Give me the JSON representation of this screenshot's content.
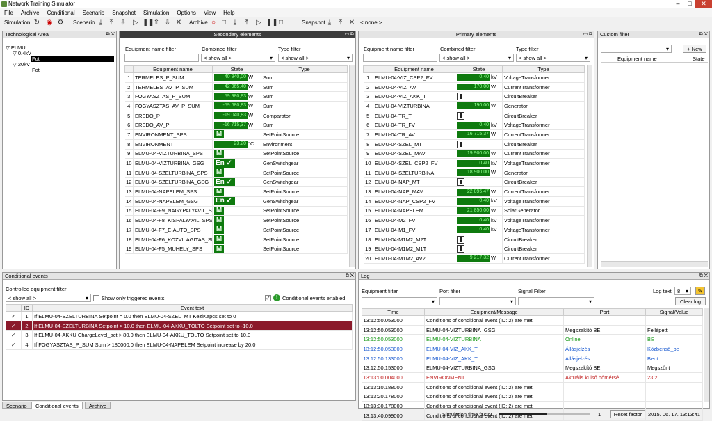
{
  "app": {
    "title": "Network Training Simulator"
  },
  "menu": [
    "File",
    "Archive",
    "Conditional",
    "Scenario",
    "Snapshot",
    "Simulation",
    "Options",
    "View",
    "Help"
  ],
  "toolbar": {
    "simulation": "Simulation",
    "scenario": "Scenario",
    "archive": "Archive",
    "snapshot": "Snapshot",
    "snapshot_value": "< none >"
  },
  "tech_area": {
    "title": "Technological Area",
    "items": [
      "ELMU",
      "0.4kV",
      "Fot",
      "20kV",
      "Fot"
    ]
  },
  "secondary": {
    "title": "Secondary elements",
    "filter_name": "Equipment name filter",
    "filter_combined": "Combined filter",
    "filter_type": "Type filter",
    "show_all": "< show all >",
    "headers": [
      "",
      "Equipment name",
      "State",
      "Type"
    ],
    "rows": [
      [
        "1",
        "TERMELES_P_SUM",
        "40 940,00",
        "W",
        "Sum"
      ],
      [
        "2",
        "TERMELES_AV_P_SUM",
        "42 965,40",
        "W",
        "Sum"
      ],
      [
        "3",
        "FOGYASZTAS_P_SUM",
        "59 980,83",
        "W",
        "Sum"
      ],
      [
        "4",
        "FOGYASZTAS_AV_P_SUM",
        "-59 680,83",
        "W",
        "Sum"
      ],
      [
        "5",
        "EREDO_P",
        "-19 040,83",
        "W",
        "Comparator"
      ],
      [
        "6",
        "EREDO_AV_P",
        "-16 715,37",
        "W",
        "Sum"
      ],
      [
        "7",
        "ENVIRONMENT_SPS",
        "M",
        "",
        "SetPointSource"
      ],
      [
        "8",
        "ENVIRONMENT",
        "23,20",
        "°C",
        "Environment"
      ],
      [
        "9",
        "ELMU-04-VIZTURBINA_SPS",
        "M",
        "",
        "SetPointSource"
      ],
      [
        "10",
        "ELMU-04-VIZTURBINA_GSG",
        "En ✓",
        "",
        "GenSwitchgear"
      ],
      [
        "11",
        "ELMU-04-SZELTURBINA_SPS",
        "M",
        "",
        "SetPointSource"
      ],
      [
        "12",
        "ELMU-04-SZELTURBINA_GSG",
        "En ✓",
        "",
        "GenSwitchgear"
      ],
      [
        "13",
        "ELMU-04-NAPELEM_SPS",
        "M",
        "",
        "SetPointSource"
      ],
      [
        "14",
        "ELMU-04-NAPELEM_GSG",
        "En ✓",
        "",
        "GenSwitchgear"
      ],
      [
        "15",
        "ELMU-04-F9_NAGYPALYAVIL_SPS",
        "M",
        "",
        "SetPointSource"
      ],
      [
        "16",
        "ELMU-04-F8_KISPALYAVIL_SPS",
        "M",
        "",
        "SetPointSource"
      ],
      [
        "17",
        "ELMU-04-F7_E-AUTO_SPS",
        "M",
        "",
        "SetPointSource"
      ],
      [
        "18",
        "ELMU-04-F6_KOZVILAGITAS_SPS",
        "M",
        "",
        "SetPointSource"
      ],
      [
        "19",
        "ELMU-04-F5_MUHELY_SPS",
        "M",
        "",
        "SetPointSource"
      ]
    ]
  },
  "primary": {
    "title": "Primary elements",
    "filter_name": "Equipment name filter",
    "filter_combined": "Combined filter",
    "filter_type": "Type filter",
    "show_all": "< show all >",
    "headers": [
      "",
      "Equipment name",
      "State",
      "Type"
    ],
    "rows": [
      [
        "1",
        "ELMU-04-VIZ_CSP2_FV",
        "0,40",
        "kV",
        "VoltageTransformer"
      ],
      [
        "2",
        "ELMU-04-VIZ_AV",
        "170,00",
        "W",
        "CurrentTransformer"
      ],
      [
        "3",
        "ELMU-04-VIZ_AKK_T",
        "cb",
        "",
        "CircuitBreaker"
      ],
      [
        "4",
        "ELMU-04-VIZTURBINA",
        "190,00",
        "W",
        "Generator"
      ],
      [
        "5",
        "ELMU-04-TR_T",
        "cb",
        "",
        "CircuitBreaker"
      ],
      [
        "6",
        "ELMU-04-TR_FV",
        "0,40",
        "kV",
        "VoltageTransformer"
      ],
      [
        "7",
        "ELMU-04-TR_AV",
        "16 715,37",
        "W",
        "CurrentTransformer"
      ],
      [
        "8",
        "ELMU-04-SZEL_MT",
        "cb",
        "",
        "CircuitBreaker"
      ],
      [
        "9",
        "ELMU-04-SZEL_MAV",
        "19 900,00",
        "W",
        "CurrentTransformer"
      ],
      [
        "10",
        "ELMU-04-SZEL_CSP2_FV",
        "0,40",
        "kV",
        "VoltageTransformer"
      ],
      [
        "11",
        "ELMU-04-SZELTURBINA",
        "18 900,00",
        "W",
        "Generator"
      ],
      [
        "12",
        "ELMU-04-NAP_MT",
        "cb",
        "",
        "CircuitBreaker"
      ],
      [
        "13",
        "ELMU-04-NAP_MAV",
        "22 895,47",
        "W",
        "CurrentTransformer"
      ],
      [
        "14",
        "ELMU-04-NAP_CSP2_FV",
        "0,40",
        "kV",
        "VoltageTransformer"
      ],
      [
        "15",
        "ELMU-04-NAPELEM",
        "21 850,00",
        "W",
        "SolarGenerator"
      ],
      [
        "16",
        "ELMU-04-M2_FV",
        "0,40",
        "kV",
        "VoltageTransformer"
      ],
      [
        "17",
        "ELMU-04-M1_FV",
        "0,40",
        "kV",
        "VoltageTransformer"
      ],
      [
        "18",
        "ELMU-04-M1M2_M2T",
        "cb",
        "",
        "CircuitBreaker"
      ],
      [
        "19",
        "ELMU-04-M1M2_M1T",
        "cb",
        "",
        "CircuitBreaker"
      ],
      [
        "20",
        "ELMU-04-M1M2_AV2",
        "-9 217,32",
        "W",
        "CurrentTransformer"
      ]
    ]
  },
  "custom": {
    "title": "Custom filter",
    "new_button": "New",
    "headers": [
      "Equipment name",
      "State"
    ]
  },
  "cond": {
    "title": "Conditional events",
    "filter": "Controlled equipment filter",
    "show_all": "< show all >",
    "only_triggered": "Show only triggered events",
    "enabled": "Conditional events enabled",
    "headers": [
      "",
      "ID",
      "Event text"
    ],
    "rows": [
      [
        "✓",
        "1",
        "If ELMU-04-SZELTURBINA Setpoint = 0.0 then ELMU-04-SZEL_MT KeziKapcs set to 0"
      ],
      [
        "✓",
        "2",
        "If ELMU-04-SZELTURBINA Setpoint > 10.0 then ELMU-04-AKKU_TOLTO Setpoint set to -10.0"
      ],
      [
        "✓",
        "3",
        "If ELMU-04-AKKU ChargeLevel_act > 80.0 then ELMU-04-AKKU_TOLTO Setpoint set to 10.0"
      ],
      [
        "✓",
        "4",
        "If FOGYASZTAS_P_SUM Sum > 180000.0 then ELMU-04-NAPELEM Setpoint increase by 20.0"
      ]
    ]
  },
  "tabs": [
    "Scenario",
    "Conditional events",
    "Archive"
  ],
  "log": {
    "title": "Log",
    "equipment_filter": "Equipment filter",
    "port_filter": "Port filter",
    "signal_filter": "Signal Filter",
    "log_text": "Log text",
    "log_text_value": "8",
    "clear": "Clear log",
    "headers": [
      "Time",
      "Equipment/Message",
      "Port",
      "Signal/Value"
    ],
    "rows": [
      [
        "13:12:50.053000",
        "Conditions of conditional event (ID: 2) are met.",
        "",
        "",
        "#000"
      ],
      [
        "13:12:50.053000",
        "ELMU-04-VIZTURBINA_GSG",
        "Megszakító BE",
        "Fellépett",
        "#000"
      ],
      [
        "13:12:50.053000",
        "ELMU-04-VIZTURBINA",
        "Online",
        "BE",
        "#1a9a1a"
      ],
      [
        "13:12:50.053000",
        "ELMU-04-VIZ_AKK_T",
        "Állásjelzés",
        "Közbenső_be",
        "#1a5ad0"
      ],
      [
        "13:12:50.133000",
        "ELMU-04-VIZ_AKK_T",
        "Állásjelzés",
        "Bent",
        "#1a5ad0"
      ],
      [
        "13:12:50.153000",
        "ELMU-04-VIZTURBINA_GSG",
        "Megszakító BE",
        "Megszűnt",
        "#000"
      ],
      [
        "13:13:00.004000",
        "ENVIRONMENT",
        "Aktuális külső hőmérsé...",
        "23.2",
        "#c02020"
      ],
      [
        "13:13:10.188000",
        "Conditions of conditional event (ID: 2) are met.",
        "",
        "",
        "#000"
      ],
      [
        "13:13:20.178000",
        "Conditions of conditional event (ID: 2) are met.",
        "",
        "",
        "#000"
      ],
      [
        "13:13:30.178000",
        "Conditions of conditional event (ID: 2) are met.",
        "",
        "",
        "#000"
      ],
      [
        "13:13:40.099000",
        "Conditions of conditional event (ID: 2) are met.",
        "",
        "",
        "#000"
      ]
    ]
  },
  "status": {
    "time_factor": "Simulation time factor",
    "factor_value": "1",
    "reset": "Reset factor",
    "datetime": "2015. 06. 17. 13:13:41"
  }
}
